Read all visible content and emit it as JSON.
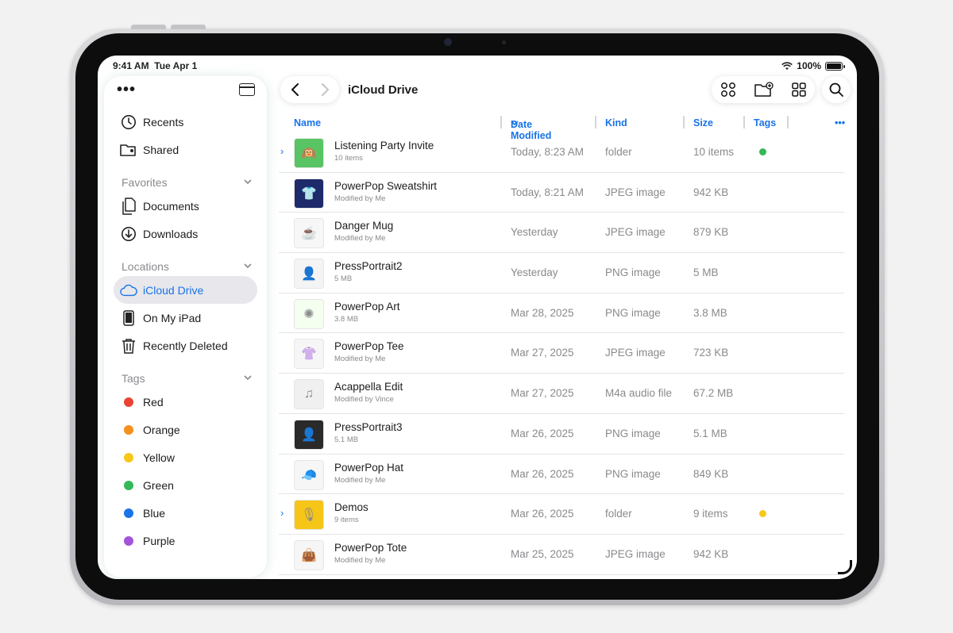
{
  "status": {
    "time": "9:41 AM",
    "date": "Tue Apr 1",
    "battery": "100%"
  },
  "sidebar": {
    "more_icon": "ellipsis-icon",
    "toggle_icon": "sidebar-toggle-icon",
    "items": [
      {
        "label": "Recents",
        "icon": "clock-icon"
      },
      {
        "label": "Shared",
        "icon": "shared-folder-icon"
      }
    ],
    "favorites": {
      "heading": "Favorites",
      "items": [
        {
          "label": "Documents",
          "icon": "document-icon"
        },
        {
          "label": "Downloads",
          "icon": "download-icon"
        }
      ]
    },
    "locations": {
      "heading": "Locations",
      "items": [
        {
          "label": "iCloud Drive",
          "icon": "cloud-icon",
          "active": true
        },
        {
          "label": "On My iPad",
          "icon": "ipad-icon"
        },
        {
          "label": "Recently Deleted",
          "icon": "trash-icon"
        }
      ]
    },
    "tags": {
      "heading": "Tags",
      "items": [
        {
          "label": "Red",
          "color": "#ea4335"
        },
        {
          "label": "Orange",
          "color": "#f5901e"
        },
        {
          "label": "Yellow",
          "color": "#f7c81b"
        },
        {
          "label": "Green",
          "color": "#34b85a"
        },
        {
          "label": "Blue",
          "color": "#1a73e8"
        },
        {
          "label": "Purple",
          "color": "#a354d8"
        }
      ]
    }
  },
  "header": {
    "title": "iCloud Drive"
  },
  "columns": {
    "name": "Name",
    "date": "Date Modified",
    "kind": "Kind",
    "size": "Size",
    "tags": "Tags",
    "more": "•••"
  },
  "files": [
    {
      "name": "Listening Party Invite",
      "sub": "10 items",
      "date": "Today, 8:23 AM",
      "kind": "folder",
      "size": "10 items",
      "tag": "#34b85a",
      "folder": true
    },
    {
      "name": "PowerPop Sweatshirt",
      "sub": "Modified by Me",
      "date": "Today, 8:21 AM",
      "kind": "JPEG image",
      "size": "942 KB"
    },
    {
      "name": "Danger Mug",
      "sub": "Modified by Me",
      "date": "Yesterday",
      "kind": "JPEG image",
      "size": "879 KB"
    },
    {
      "name": "PressPortrait2",
      "sub": "5 MB",
      "date": "Yesterday",
      "kind": "PNG image",
      "size": "5 MB"
    },
    {
      "name": "PowerPop Art",
      "sub": "3.8 MB",
      "date": "Mar 28, 2025",
      "kind": "PNG image",
      "size": "3.8 MB"
    },
    {
      "name": "PowerPop Tee",
      "sub": "Modified by Me",
      "date": "Mar 27, 2025",
      "kind": "JPEG image",
      "size": "723 KB"
    },
    {
      "name": "Acappella Edit",
      "sub": "Modified by Vince",
      "date": "Mar 27, 2025",
      "kind": "M4a audio file",
      "size": "67.2 MB"
    },
    {
      "name": "PressPortrait3",
      "sub": "5.1 MB",
      "date": "Mar 26, 2025",
      "kind": "PNG image",
      "size": "5.1 MB"
    },
    {
      "name": "PowerPop Hat",
      "sub": "Modified by Me",
      "date": "Mar 26, 2025",
      "kind": "PNG image",
      "size": "849 KB"
    },
    {
      "name": "Demos",
      "sub": "9 items",
      "date": "Mar 26, 2025",
      "kind": "folder",
      "size": "9 items",
      "tag": "#f7c81b",
      "folder": true
    },
    {
      "name": "PowerPop Tote",
      "sub": "Modified by Me",
      "date": "Mar 25, 2025",
      "kind": "JPEG image",
      "size": "942 KB"
    }
  ]
}
